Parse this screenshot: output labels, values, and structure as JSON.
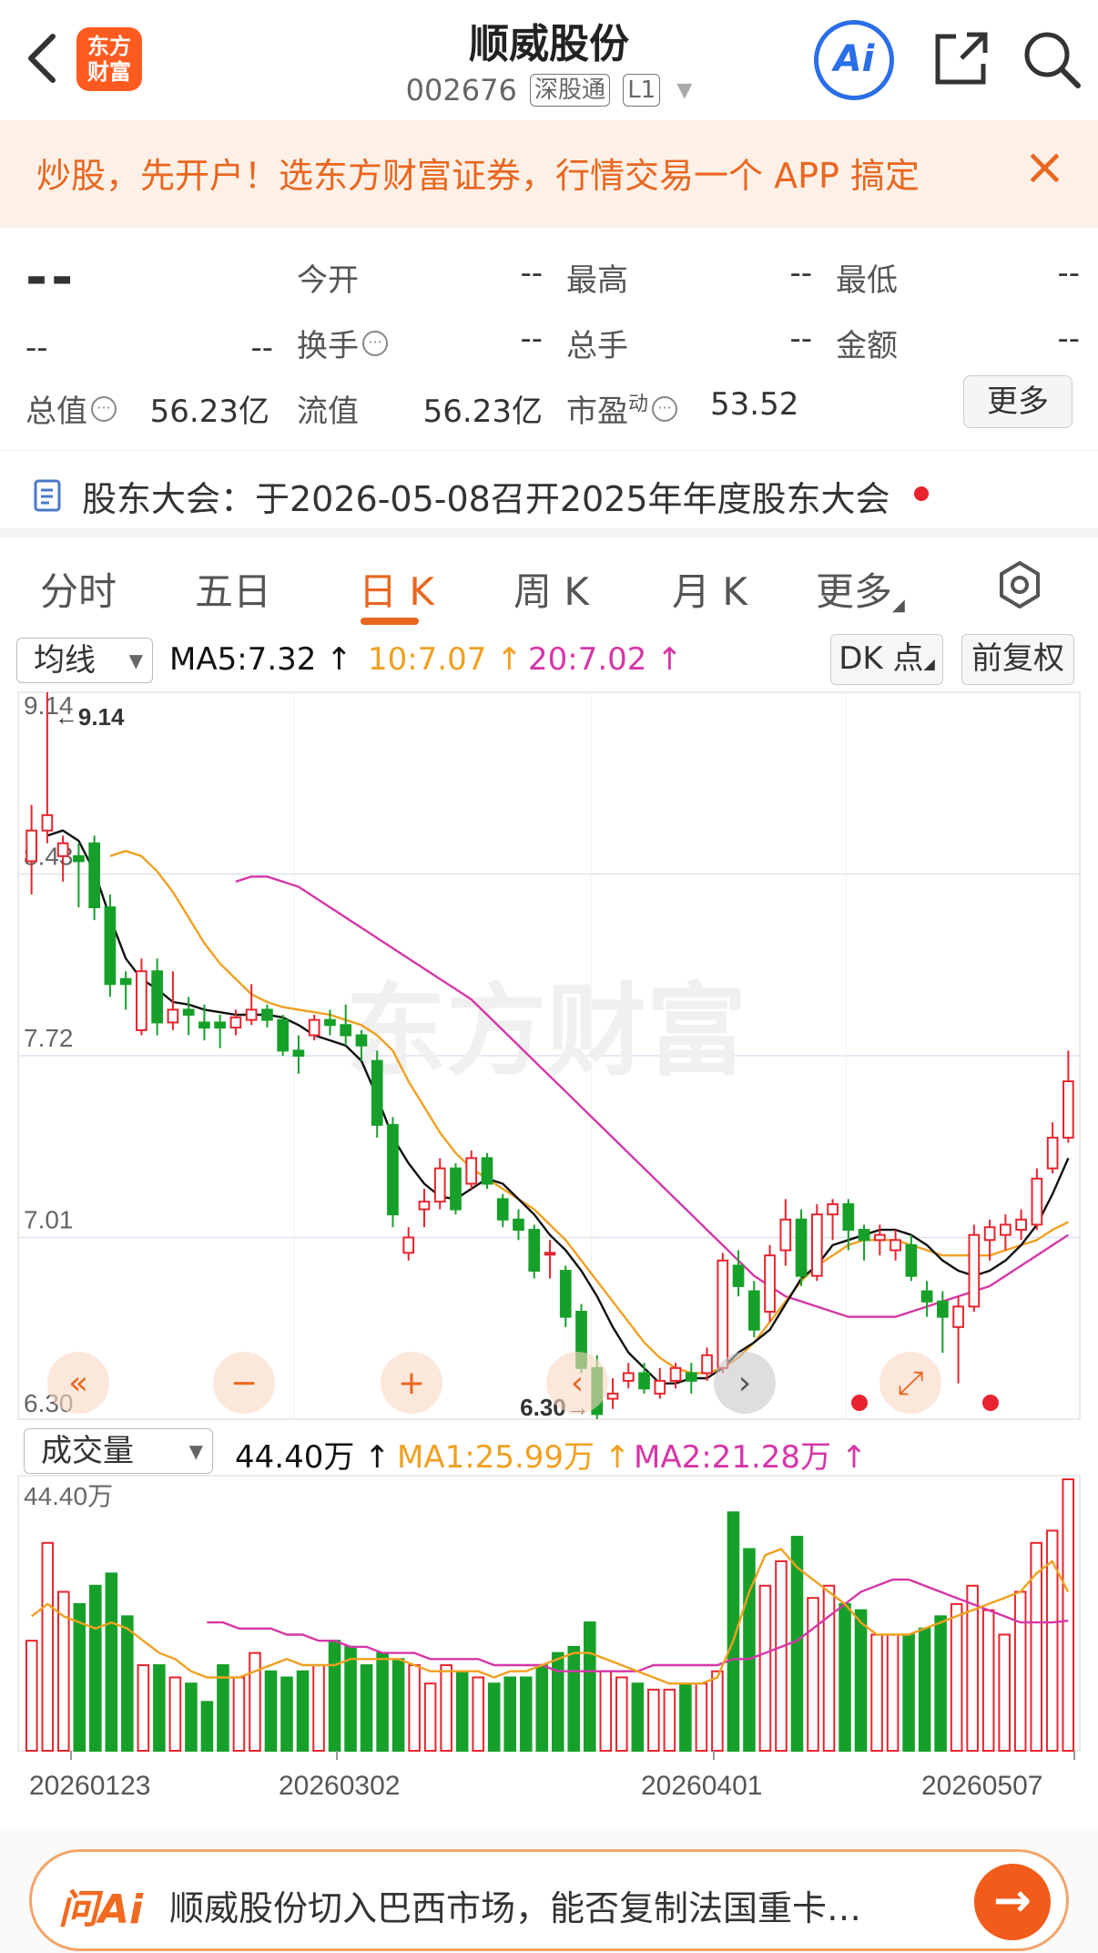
{
  "header": {
    "back_icon": "chevron-left",
    "logo_text": [
      "东方",
      "财富"
    ],
    "title": "顺威股份",
    "code": "002676",
    "tag_connect": "深股通",
    "tag_level": "L1",
    "ai_label": "Ai"
  },
  "promo": {
    "text": "炒股，先开户！选东方财富证券，行情交易一个 APP 搞定",
    "close": "×"
  },
  "quote": {
    "price": "--",
    "change": "--",
    "change_pct": "--",
    "open_label": "今开",
    "open": "--",
    "high_label": "最高",
    "high": "--",
    "low_label": "最低",
    "low": "--",
    "turnover_label": "换手",
    "turnover": "--",
    "volume_label": "总手",
    "volume": "--",
    "amount_label": "金额",
    "amount": "--",
    "mktcap_label": "总值",
    "mktcap": "56.23亿",
    "float_label": "流值",
    "float": "56.23亿",
    "pe_label": "市盈",
    "pe_sup": "动",
    "pe": "53.52",
    "more_label": "更多"
  },
  "notice": {
    "text": "股东大会：于2026-05-08召开2025年年度股东大会"
  },
  "tabs": [
    "分时",
    "五日",
    "日 K",
    "周 K",
    "月 K",
    "更多"
  ],
  "active_tab": 2,
  "legend": {
    "indicator": "均线",
    "ma5": "MA5:7.32 ↑",
    "ma10": "10:7.07 ↑",
    "ma20": "20:7.02 ↑",
    "dk_label": "DK 点",
    "adjust_label": "前复权"
  },
  "vol_legend": {
    "indicator": "成交量",
    "vol": "44.40万 ↑",
    "ma1": "MA1:25.99万 ↑",
    "ma2": "MA2:21.28万 ↑"
  },
  "colors": {
    "up": "#e8242e",
    "down": "#16a02a",
    "ma5": "#111111",
    "ma10": "#f0a020",
    "ma20": "#d636a8",
    "accent": "#e9661f"
  },
  "chart_data": {
    "type": "candlestick",
    "price_axis_labels": [
      "9.14",
      "8.43",
      "7.72",
      "7.01",
      "6.30"
    ],
    "ylim": [
      6.3,
      9.14
    ],
    "max_marker": "9.14",
    "min_marker": "6.30",
    "volume_axis_label": "44.40万",
    "volume_max": 44.4,
    "dates": [
      "20260123",
      "20260302",
      "20260401",
      "20260507"
    ],
    "candles": [
      {
        "o": 8.48,
        "c": 8.6,
        "h": 8.7,
        "l": 8.35
      },
      {
        "o": 8.6,
        "c": 8.66,
        "h": 9.14,
        "l": 8.55
      },
      {
        "o": 8.5,
        "c": 8.55,
        "h": 8.58,
        "l": 8.4
      },
      {
        "o": 8.5,
        "c": 8.48,
        "h": 8.55,
        "l": 8.3
      },
      {
        "o": 8.55,
        "c": 8.3,
        "h": 8.58,
        "l": 8.25
      },
      {
        "o": 8.3,
        "c": 8.0,
        "h": 8.35,
        "l": 7.95
      },
      {
        "o": 8.02,
        "c": 8.0,
        "h": 8.05,
        "l": 7.9
      },
      {
        "o": 7.82,
        "c": 8.05,
        "h": 8.1,
        "l": 7.8
      },
      {
        "o": 8.05,
        "c": 7.85,
        "h": 8.1,
        "l": 7.8
      },
      {
        "o": 7.85,
        "c": 7.9,
        "h": 8.05,
        "l": 7.82
      },
      {
        "o": 7.9,
        "c": 7.88,
        "h": 7.95,
        "l": 7.8
      },
      {
        "o": 7.85,
        "c": 7.83,
        "h": 7.92,
        "l": 7.78
      },
      {
        "o": 7.85,
        "c": 7.83,
        "h": 7.88,
        "l": 7.75
      },
      {
        "o": 7.83,
        "c": 7.87,
        "h": 7.9,
        "l": 7.8
      },
      {
        "o": 7.86,
        "c": 7.9,
        "h": 8.0,
        "l": 7.84
      },
      {
        "o": 7.9,
        "c": 7.86,
        "h": 7.92,
        "l": 7.83
      },
      {
        "o": 7.86,
        "c": 7.74,
        "h": 7.88,
        "l": 7.72
      },
      {
        "o": 7.74,
        "c": 7.72,
        "h": 7.8,
        "l": 7.65
      },
      {
        "o": 7.8,
        "c": 7.86,
        "h": 7.88,
        "l": 7.78
      },
      {
        "o": 7.86,
        "c": 7.84,
        "h": 7.9,
        "l": 7.8
      },
      {
        "o": 7.84,
        "c": 7.8,
        "h": 7.92,
        "l": 7.76
      },
      {
        "o": 7.8,
        "c": 7.76,
        "h": 7.82,
        "l": 7.7
      },
      {
        "o": 7.7,
        "c": 7.45,
        "h": 7.74,
        "l": 7.4
      },
      {
        "o": 7.45,
        "c": 7.1,
        "h": 7.48,
        "l": 7.05
      },
      {
        "o": 6.95,
        "c": 7.01,
        "h": 7.05,
        "l": 6.92
      },
      {
        "o": 7.12,
        "c": 7.15,
        "h": 7.2,
        "l": 7.05
      },
      {
        "o": 7.15,
        "c": 7.28,
        "h": 7.32,
        "l": 7.12
      },
      {
        "o": 7.28,
        "c": 7.12,
        "h": 7.3,
        "l": 7.1
      },
      {
        "o": 7.22,
        "c": 7.32,
        "h": 7.35,
        "l": 7.2
      },
      {
        "o": 7.32,
        "c": 7.22,
        "h": 7.34,
        "l": 7.2
      },
      {
        "o": 7.16,
        "c": 7.08,
        "h": 7.18,
        "l": 7.05
      },
      {
        "o": 7.08,
        "c": 7.04,
        "h": 7.12,
        "l": 7.0
      },
      {
        "o": 7.04,
        "c": 6.88,
        "h": 7.06,
        "l": 6.85
      },
      {
        "o": 6.95,
        "c": 6.95,
        "h": 7.0,
        "l": 6.85
      },
      {
        "o": 6.88,
        "c": 6.7,
        "h": 6.9,
        "l": 6.66
      },
      {
        "o": 6.72,
        "c": 6.5,
        "h": 6.75,
        "l": 6.48
      },
      {
        "o": 6.5,
        "c": 6.32,
        "h": 6.55,
        "l": 6.3
      },
      {
        "o": 6.38,
        "c": 6.4,
        "h": 6.46,
        "l": 6.34
      },
      {
        "o": 6.45,
        "c": 6.48,
        "h": 6.52,
        "l": 6.42
      },
      {
        "o": 6.48,
        "c": 6.42,
        "h": 6.52,
        "l": 6.4
      },
      {
        "o": 6.4,
        "c": 6.45,
        "h": 6.5,
        "l": 6.38
      },
      {
        "o": 6.45,
        "c": 6.5,
        "h": 6.52,
        "l": 6.42
      },
      {
        "o": 6.48,
        "c": 6.45,
        "h": 6.52,
        "l": 6.4
      },
      {
        "o": 6.48,
        "c": 6.55,
        "h": 6.58,
        "l": 6.45
      },
      {
        "o": 6.5,
        "c": 6.92,
        "h": 6.95,
        "l": 6.48
      },
      {
        "o": 6.9,
        "c": 6.82,
        "h": 6.96,
        "l": 6.78
      },
      {
        "o": 6.8,
        "c": 6.65,
        "h": 6.84,
        "l": 6.62
      },
      {
        "o": 6.72,
        "c": 6.94,
        "h": 6.98,
        "l": 6.68
      },
      {
        "o": 6.96,
        "c": 7.08,
        "h": 7.16,
        "l": 6.9
      },
      {
        "o": 7.08,
        "c": 6.86,
        "h": 7.12,
        "l": 6.82
      },
      {
        "o": 6.86,
        "c": 7.1,
        "h": 7.14,
        "l": 6.84
      },
      {
        "o": 7.1,
        "c": 7.14,
        "h": 7.16,
        "l": 7.0
      },
      {
        "o": 7.14,
        "c": 7.04,
        "h": 7.16,
        "l": 6.96
      },
      {
        "o": 7.04,
        "c": 7.0,
        "h": 7.06,
        "l": 6.92
      },
      {
        "o": 7.0,
        "c": 7.02,
        "h": 7.06,
        "l": 6.94
      },
      {
        "o": 6.96,
        "c": 7.0,
        "h": 7.04,
        "l": 6.92
      },
      {
        "o": 6.98,
        "c": 6.86,
        "h": 7.02,
        "l": 6.84
      },
      {
        "o": 6.8,
        "c": 6.76,
        "h": 6.84,
        "l": 6.7
      },
      {
        "o": 6.76,
        "c": 6.7,
        "h": 6.8,
        "l": 6.56
      },
      {
        "o": 6.66,
        "c": 6.74,
        "h": 6.78,
        "l": 6.44
      },
      {
        "o": 6.74,
        "c": 7.02,
        "h": 7.06,
        "l": 6.72
      },
      {
        "o": 7.0,
        "c": 7.05,
        "h": 7.08,
        "l": 6.92
      },
      {
        "o": 7.02,
        "c": 7.06,
        "h": 7.1,
        "l": 6.96
      },
      {
        "o": 7.04,
        "c": 7.08,
        "h": 7.12,
        "l": 7.0
      },
      {
        "o": 7.06,
        "c": 7.24,
        "h": 7.28,
        "l": 7.04
      },
      {
        "o": 7.28,
        "c": 7.4,
        "h": 7.46,
        "l": 7.26
      },
      {
        "o": 7.4,
        "c": 7.62,
        "h": 7.74,
        "l": 7.38
      }
    ],
    "ma5": [
      8.58,
      8.6,
      8.56,
      8.44,
      8.26,
      8.1,
      8.02,
      7.98,
      7.93,
      7.92,
      7.9,
      7.89,
      7.88,
      7.88,
      7.88,
      7.87,
      7.84,
      7.8,
      7.78,
      7.76,
      7.7,
      7.56,
      7.4,
      7.3,
      7.22,
      7.17,
      7.16,
      7.2,
      7.24,
      7.22,
      7.16,
      7.1,
      7.02,
      6.96,
      6.88,
      6.78,
      6.66,
      6.56,
      6.5,
      6.44,
      6.44,
      6.46,
      6.46,
      6.5,
      6.56,
      6.6,
      6.65,
      6.75,
      6.85,
      6.9,
      6.98,
      7.0,
      7.02,
      7.04,
      7.04,
      7.02,
      6.98,
      6.92,
      6.88,
      6.86,
      6.88,
      6.92,
      6.98,
      7.06,
      7.18,
      7.32
    ],
    "ma10": [
      8.5,
      8.52,
      8.5,
      8.44,
      8.36,
      8.26,
      8.16,
      8.08,
      8.02,
      7.96,
      7.93,
      7.91,
      7.9,
      7.89,
      7.88,
      7.86,
      7.84,
      7.8,
      7.74,
      7.62,
      7.52,
      7.42,
      7.34,
      7.28,
      7.24,
      7.2,
      7.16,
      7.12,
      7.06,
      7.0,
      6.92,
      6.84,
      6.76,
      6.68,
      6.6,
      6.54,
      6.5,
      6.48,
      6.48,
      6.5,
      6.54,
      6.6,
      6.68,
      6.76,
      6.84,
      6.9,
      6.94,
      6.98,
      7.0,
      7.0,
      7.0,
      6.98,
      6.96,
      6.94,
      6.94,
      6.94,
      6.94,
      6.96,
      6.98,
      7.0,
      7.04,
      7.07
    ],
    "ma20": [
      8.4,
      8.42,
      8.42,
      8.4,
      8.38,
      8.34,
      8.3,
      8.26,
      8.22,
      8.18,
      8.14,
      8.1,
      8.06,
      8.02,
      7.98,
      7.94,
      7.88,
      7.82,
      7.76,
      7.7,
      7.64,
      7.58,
      7.52,
      7.46,
      7.4,
      7.34,
      7.28,
      7.22,
      7.16,
      7.1,
      7.04,
      6.98,
      6.92,
      6.86,
      6.82,
      6.78,
      6.76,
      6.74,
      6.72,
      6.7,
      6.7,
      6.7,
      6.7,
      6.72,
      6.74,
      6.76,
      6.78,
      6.8,
      6.82,
      6.86,
      6.9,
      6.94,
      6.98,
      7.02
    ],
    "volumes": [
      18,
      34,
      26,
      24,
      27,
      29,
      22,
      14,
      14,
      12,
      11,
      8,
      14,
      12,
      16,
      13,
      12,
      13,
      14,
      18,
      17,
      14,
      16,
      15,
      14,
      11,
      14,
      13,
      12,
      11,
      12,
      12,
      14,
      16,
      17,
      21,
      13,
      12,
      11,
      10,
      10,
      11,
      11,
      13,
      39,
      33,
      27,
      31,
      35,
      25,
      27,
      24,
      23,
      19,
      19,
      19,
      20,
      22,
      24,
      27,
      23,
      19,
      26,
      34,
      36,
      44.4
    ],
    "vol_ma1": [
      22,
      24,
      22,
      21,
      20,
      21,
      20,
      18,
      16,
      15,
      13,
      12,
      12,
      12,
      13,
      14,
      15,
      14,
      14,
      14,
      15,
      15,
      15,
      15,
      14,
      13,
      13,
      13,
      13,
      12,
      13,
      13,
      14,
      15,
      16,
      16,
      15,
      14,
      13,
      12,
      11,
      11,
      11,
      12,
      18,
      26,
      32,
      33,
      30,
      28,
      26,
      24,
      21,
      19,
      19,
      19,
      20,
      21,
      22,
      23,
      24,
      25,
      26,
      29,
      31,
      25.99
    ],
    "vol_ma2": [
      21,
      21,
      20,
      20,
      20,
      19,
      19,
      18,
      18,
      17,
      17,
      16,
      16,
      16,
      15,
      15,
      15,
      15,
      14,
      14,
      14,
      14,
      13,
      13,
      13,
      13,
      13,
      13,
      14,
      14,
      14,
      14,
      14,
      15,
      15,
      16,
      17,
      18,
      20,
      22,
      24,
      26,
      27,
      28,
      28,
      27,
      26,
      25,
      24,
      23,
      22,
      21,
      21,
      21,
      21.28
    ]
  },
  "chart_controls": [
    "«",
    "−",
    "+",
    "‹",
    "›",
    "⤢"
  ],
  "ask": {
    "logo": "问Ai",
    "text": "顺威股份切入巴西市场，能否复制法国重卡…",
    "go": "→"
  }
}
